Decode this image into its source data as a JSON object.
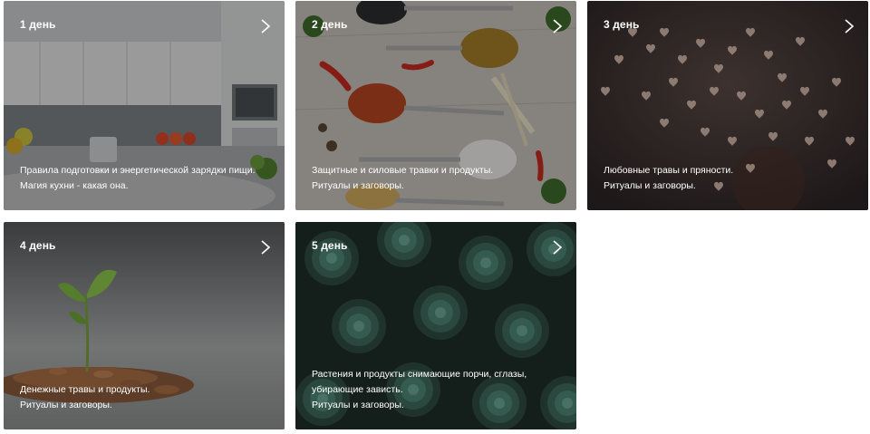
{
  "cards": [
    {
      "day": "1 день",
      "lines": [
        "Правила подготовки и энергетической зарядки пищи.",
        "Магия кухни - какая она."
      ],
      "image": "kitchen-photo"
    },
    {
      "day": "2 день",
      "lines": [
        "Защитные и силовые травки и продукты.",
        "Ритуалы и заговоры."
      ],
      "image": "spices-photo"
    },
    {
      "day": "3 день",
      "lines": [
        "Любовные травы и пряности.",
        "Ритуалы и заговоры."
      ],
      "image": "hearts-bokeh-photo"
    },
    {
      "day": "4 день",
      "lines": [
        "Денежные травы и продукты.",
        "Ритуалы и заговоры."
      ],
      "image": "coins-sprout-photo"
    },
    {
      "day": "5 день",
      "lines": [
        "Растения и продукты снимающие порчи, сглазы,",
        "убирающие зависть.",
        "Ритуалы и заговоры."
      ],
      "image": "succulents-photo"
    }
  ],
  "icons": {
    "next": "chevron-right-icon"
  }
}
